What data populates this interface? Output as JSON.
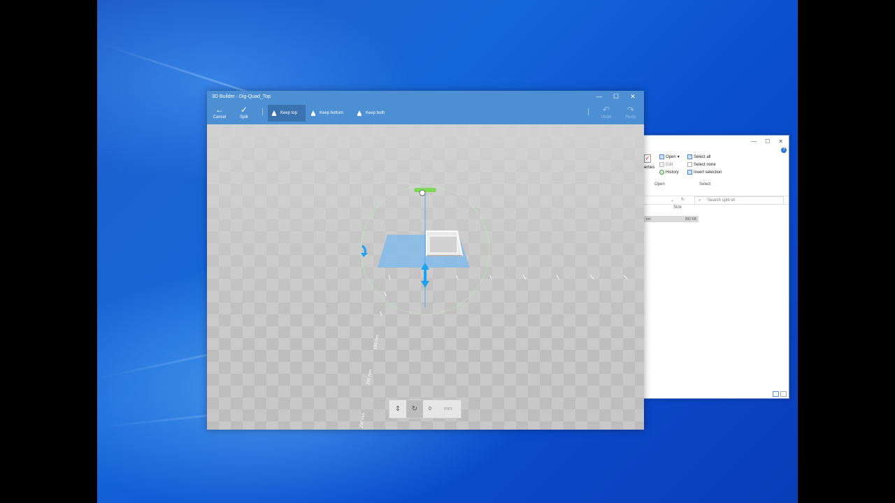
{
  "builder": {
    "title": "3D Builder - Dig-Quad_Top",
    "toolbar": {
      "cancel": "Cancel",
      "split": "Split",
      "keep_top": "Keep top",
      "keep_bottom": "Keep bottom",
      "keep_both": "Keep both",
      "undo": "Undo",
      "redo": "Redo"
    },
    "ruler_labels": [
      "150 mm",
      "200 mm",
      "250 mm"
    ],
    "bottom": {
      "value": "0",
      "unit": "mm"
    }
  },
  "explorer": {
    "ribbon": {
      "properties": "Properties",
      "open": "Open",
      "edit": "Edit",
      "history": "History",
      "select_all": "Select all",
      "select_none": "Select none",
      "invert_selection": "Invert selection",
      "group_open": "Open",
      "group_select": "Select"
    },
    "search_placeholder": "Search split stl",
    "column_size": "Size",
    "file": {
      "name": "ect",
      "size": "392 KB"
    }
  },
  "colors": {
    "accent": "#4c8fd3",
    "desktop": "#1566d9",
    "plane": "#7ab8ee",
    "gizmo": "#1da1f2",
    "handle": "#7ed957"
  }
}
